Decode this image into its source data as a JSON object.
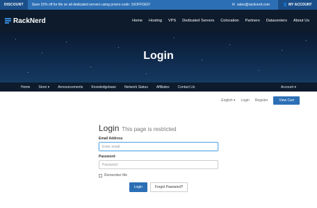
{
  "promo": {
    "tag": "DISCOUNT",
    "message": "Save 15% off for life on all dedicated servers using promo code: 15OFFDED!",
    "email": "sales@racknerd.com",
    "account": "MY ACCOUNT"
  },
  "header": {
    "brand": "RackNerd",
    "nav": [
      "Home",
      "Hosting",
      "VPS",
      "Dedicated Servers",
      "Colocation",
      "Partners",
      "Datacenters",
      "About Us"
    ]
  },
  "hero": {
    "title": "Login"
  },
  "subnav": {
    "items": [
      "Home",
      "Store ▾",
      "Announcements",
      "Knowledgebase",
      "Network Status",
      "Affiliates",
      "Contact Us"
    ],
    "account": "Account ▾"
  },
  "util": {
    "language": "English ▾",
    "login": "Login",
    "register": "Register",
    "cart": "View Cart"
  },
  "login": {
    "title": "Login",
    "subtitle": "This page is restricted",
    "email_label": "Email Address",
    "email_placeholder": "Enter email",
    "password_label": "Password",
    "password_placeholder": "Password",
    "remember": "Remember Me",
    "login_button": "Login",
    "forgot_button": "Forgot Password?"
  },
  "colors": {
    "accent": "#2c6fb5",
    "dark": "#0d1b2c"
  }
}
